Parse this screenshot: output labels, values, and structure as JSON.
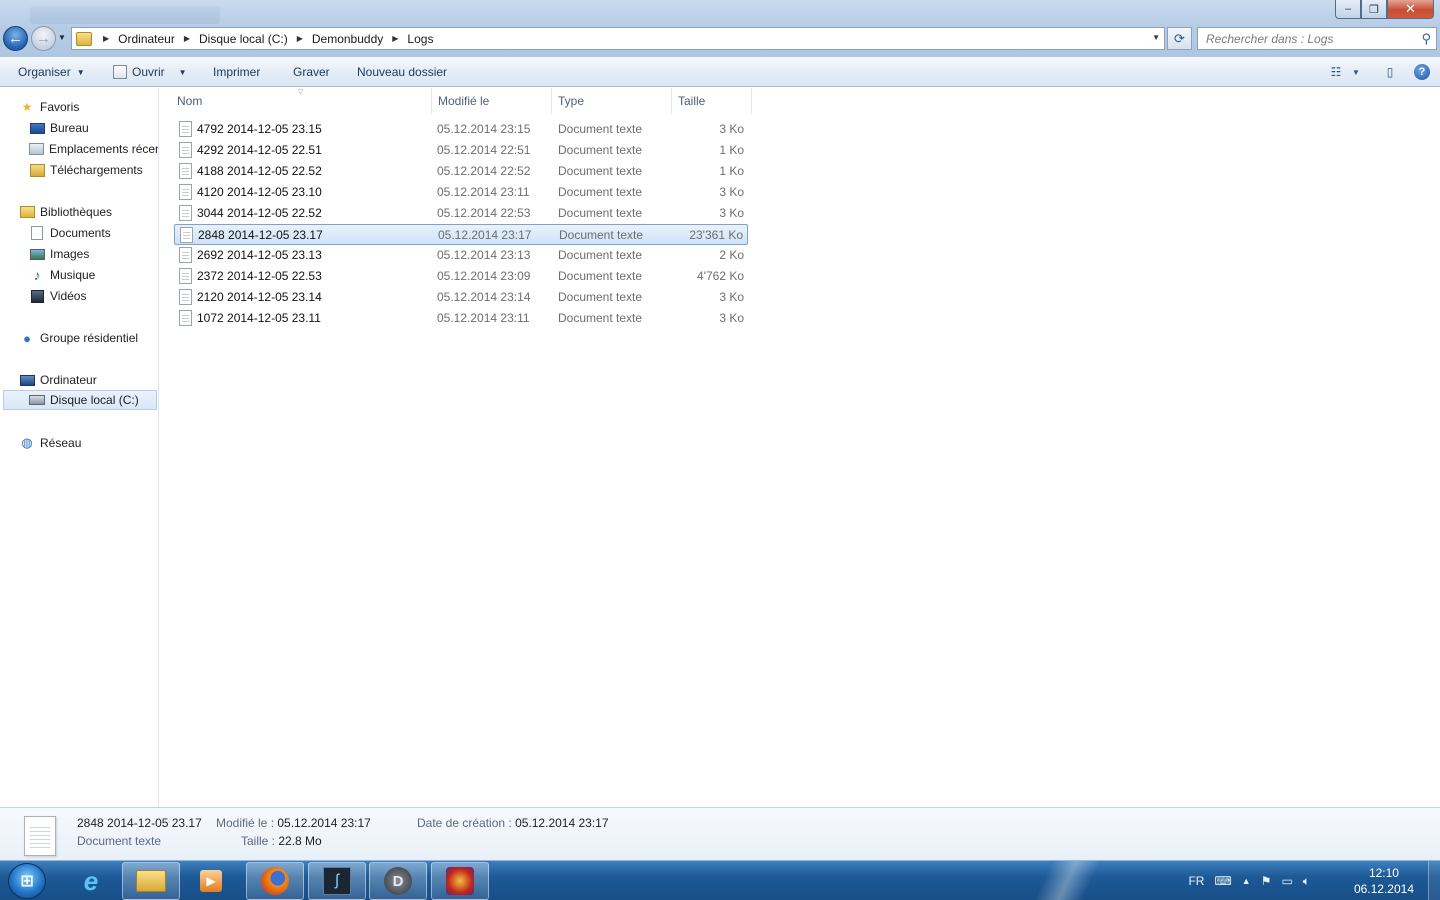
{
  "window": {
    "minimize_label": "–",
    "maximize_label": "❐",
    "close_label": "✕"
  },
  "address": {
    "crumbs": [
      "Ordinateur",
      "Disque local (C:)",
      "Demonbuddy",
      "Logs"
    ]
  },
  "search": {
    "placeholder": "Rechercher dans : Logs"
  },
  "toolbar": {
    "organize_label": "Organiser",
    "open_label": "Ouvrir",
    "print_label": "Imprimer",
    "burn_label": "Graver",
    "new_folder_label": "Nouveau dossier",
    "help_label": "?"
  },
  "sidebar": {
    "items": [
      {
        "label": "Favoris",
        "icon": "star-icon"
      },
      {
        "label": "Bureau",
        "icon": "desktop-icon"
      },
      {
        "label": "Emplacements récents",
        "icon": "recent-places-icon"
      },
      {
        "label": "Téléchargements",
        "icon": "downloads-icon"
      },
      {
        "label": "Bibliothèques",
        "icon": "libraries-icon"
      },
      {
        "label": "Documents",
        "icon": "documents-icon"
      },
      {
        "label": "Images",
        "icon": "images-icon"
      },
      {
        "label": "Musique",
        "icon": "music-icon"
      },
      {
        "label": "Vidéos",
        "icon": "videos-icon"
      },
      {
        "label": "Groupe résidentiel",
        "icon": "homegroup-icon"
      },
      {
        "label": "Ordinateur",
        "icon": "computer-icon"
      },
      {
        "label": "Disque local (C:)",
        "icon": "drive-icon"
      },
      {
        "label": "Réseau",
        "icon": "network-icon"
      }
    ],
    "selected": "Disque local (C:)"
  },
  "table": {
    "columns": [
      "Nom",
      "Modifié le",
      "Type",
      "Taille"
    ],
    "rows": [
      {
        "name": "4792 2014-12-05 23.15",
        "date": "05.12.2014 23:15",
        "type": "Document texte",
        "size": "3 Ko"
      },
      {
        "name": "4292 2014-12-05 22.51",
        "date": "05.12.2014 22:51",
        "type": "Document texte",
        "size": "1 Ko"
      },
      {
        "name": "4188 2014-12-05 22.52",
        "date": "05.12.2014 22:52",
        "type": "Document texte",
        "size": "1 Ko"
      },
      {
        "name": "4120 2014-12-05 23.10",
        "date": "05.12.2014 23:11",
        "type": "Document texte",
        "size": "3 Ko"
      },
      {
        "name": "3044 2014-12-05 22.52",
        "date": "05.12.2014 22:53",
        "type": "Document texte",
        "size": "3 Ko"
      },
      {
        "name": "2848 2014-12-05 23.17",
        "date": "05.12.2014 23:17",
        "type": "Document texte",
        "size": "23'361 Ko"
      },
      {
        "name": "2692 2014-12-05 23.13",
        "date": "05.12.2014 23:13",
        "type": "Document texte",
        "size": "2 Ko"
      },
      {
        "name": "2372 2014-12-05 22.53",
        "date": "05.12.2014 23:09",
        "type": "Document texte",
        "size": "4'762 Ko"
      },
      {
        "name": "2120 2014-12-05 23.14",
        "date": "05.12.2014 23:14",
        "type": "Document texte",
        "size": "3 Ko"
      },
      {
        "name": "1072 2014-12-05 23.11",
        "date": "05.12.2014 23:11",
        "type": "Document texte",
        "size": "3 Ko"
      }
    ],
    "selected_row": "2848 2014-12-05 23.17"
  },
  "details": {
    "name": "2848 2014-12-05 23.17",
    "type": "Document texte",
    "modified_key": "Modifié le :",
    "modified_value": "05.12.2014 23:17",
    "size_key": "Taille :",
    "size_value": "22.8 Mo",
    "created_key": "Date de création :",
    "created_value": "05.12.2014 23:17"
  },
  "taskbar": {
    "language": "FR",
    "time": "12:10",
    "date": "06.12.2014",
    "apps": [
      "windows-explorer-icon",
      "media-player-icon",
      "firefox-icon",
      "demonbuddy-icon",
      "diablo-icon",
      "game-icon"
    ]
  },
  "colors": {
    "selection_bg": "#cfe2f8",
    "selection_border": "#7da2ce",
    "toolbar_text": "#1e395b",
    "taskbar": "#1d5a97"
  }
}
